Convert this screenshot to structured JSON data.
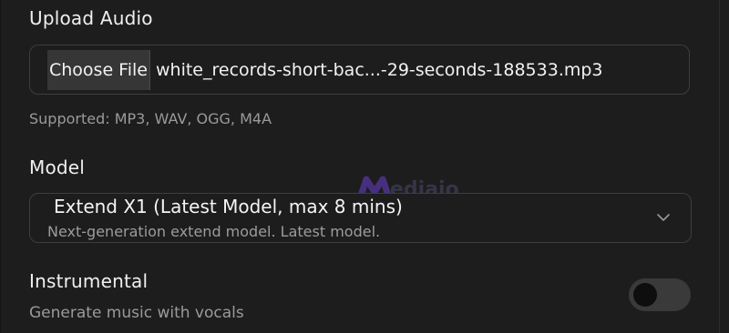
{
  "upload": {
    "label": "Upload Audio",
    "choose_button": "Choose File",
    "file_name": "white_records-short-bac...-29-seconds-188533.mp3",
    "supported": "Supported: MP3, WAV, OGG, M4A"
  },
  "model": {
    "label": "Model",
    "selected": "Extend X1 (Latest Model, max 8 mins)",
    "description": "Next-generation extend model. Latest model."
  },
  "watermark": {
    "text": "ediaio"
  },
  "instrumental": {
    "label": "Instrumental",
    "description": "Generate music with vocals",
    "toggle_on": false
  },
  "colors": {
    "background": "#1d1d1d",
    "border": "#3e3e3e",
    "text": "#f0f0f0",
    "muted": "#9a9a9a"
  }
}
